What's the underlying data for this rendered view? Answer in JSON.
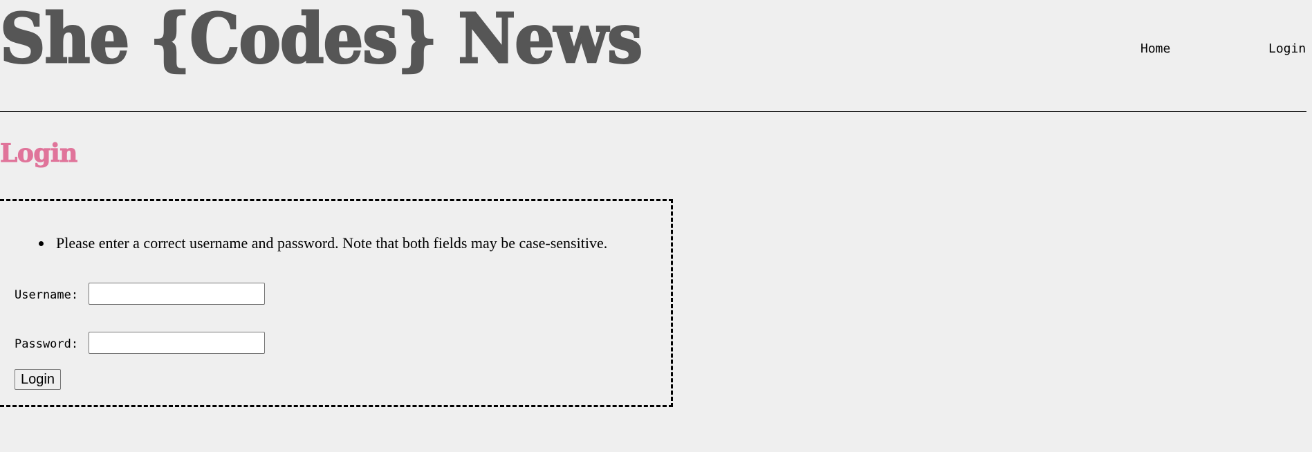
{
  "header": {
    "site_title": "She {Codes} News",
    "nav": {
      "home": "Home",
      "login": "Login"
    }
  },
  "main": {
    "heading": "Login",
    "form": {
      "errors": [
        "Please enter a correct username and password. Note that both fields may be case-sensitive."
      ],
      "username_label": "Username:",
      "username_value": "",
      "password_label": "Password:",
      "password_value": "",
      "submit_label": "Login"
    }
  },
  "colors": {
    "background": "#efefef",
    "title": "#565656",
    "heading_accent": "#e0749a",
    "text": "#000000"
  }
}
